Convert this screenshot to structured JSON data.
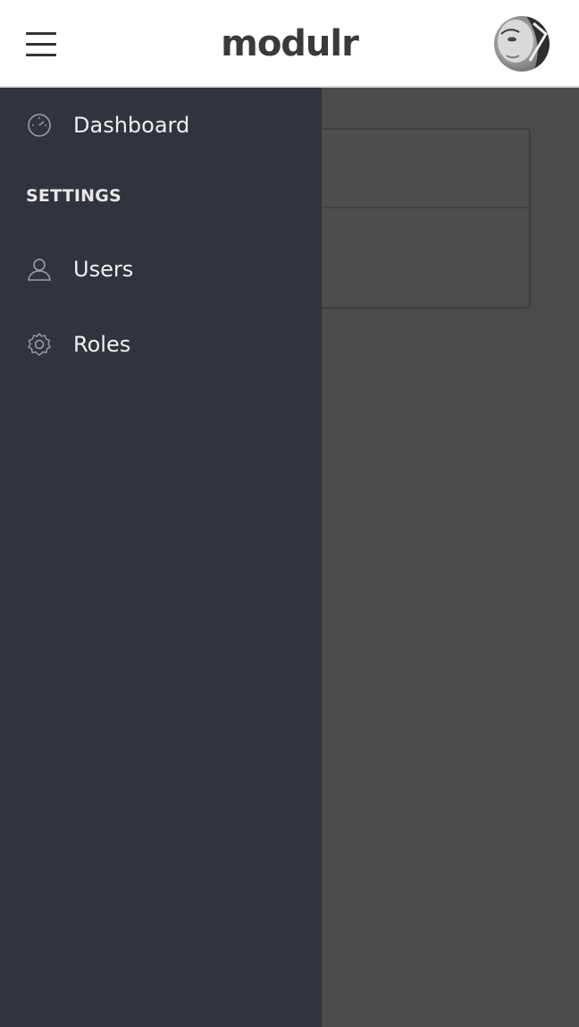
{
  "header": {
    "menu_icon": "hamburger-icon",
    "logo_text": "modulr",
    "avatar_icon": "user-avatar"
  },
  "sidebar": {
    "items": [
      {
        "label": "Dashboard",
        "icon": "speedometer-icon"
      }
    ],
    "sections": [
      {
        "title": "SETTINGS",
        "items": [
          {
            "label": "Users",
            "icon": "user-icon"
          },
          {
            "label": "Roles",
            "icon": "gear-icon"
          }
        ]
      }
    ]
  },
  "colors": {
    "drawer_bg": "#31343c",
    "overlay_bg": "#4a4b4b",
    "header_bg": "#ffffff",
    "logo": "#3a3a3a"
  }
}
